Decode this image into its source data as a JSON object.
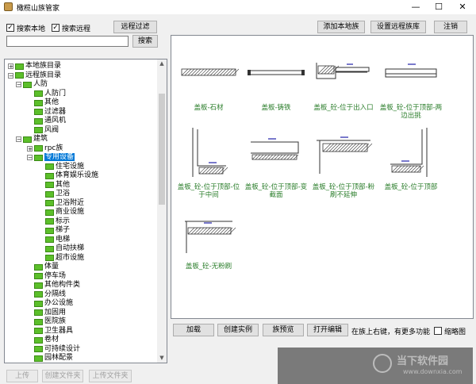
{
  "window": {
    "title": "橄榄山族管家",
    "minimize": "—",
    "maximize": "☐",
    "close": "✕"
  },
  "search": {
    "local_label": "搜索本地",
    "remote_label": "搜索远程",
    "local_checked": true,
    "remote_checked": true,
    "remote_filter_btn": "远程过滤",
    "query_value": "",
    "search_btn": "搜索"
  },
  "topbar": {
    "add_local": "添加本地族",
    "set_remote": "设置远程族库",
    "logout": "注销"
  },
  "tree": [
    {
      "label": "本地族目录",
      "level": 0,
      "expander": "+"
    },
    {
      "label": "远程族目录",
      "level": 0,
      "expander": "−"
    },
    {
      "label": "人防",
      "level": 1,
      "expander": "−"
    },
    {
      "label": "人防门",
      "level": 2,
      "expander": ""
    },
    {
      "label": "其他",
      "level": 2,
      "expander": ""
    },
    {
      "label": "过滤器",
      "level": 2,
      "expander": ""
    },
    {
      "label": "通风机",
      "level": 2,
      "expander": ""
    },
    {
      "label": "风阀",
      "level": 2,
      "expander": ""
    },
    {
      "label": "建筑",
      "level": 1,
      "expander": "−"
    },
    {
      "label": "rpc族",
      "level": 2,
      "expander": "+"
    },
    {
      "label": "专用设备",
      "level": 2,
      "expander": "−",
      "selected": true
    },
    {
      "label": "住宅设施",
      "level": 3,
      "expander": ""
    },
    {
      "label": "体育娱乐设施",
      "level": 3,
      "expander": ""
    },
    {
      "label": "其他",
      "level": 3,
      "expander": ""
    },
    {
      "label": "卫浴",
      "level": 3,
      "expander": ""
    },
    {
      "label": "卫浴附近",
      "level": 3,
      "expander": ""
    },
    {
      "label": "商业设施",
      "level": 3,
      "expander": ""
    },
    {
      "label": "标示",
      "level": 3,
      "expander": ""
    },
    {
      "label": "梯子",
      "level": 3,
      "expander": ""
    },
    {
      "label": "电梯",
      "level": 3,
      "expander": ""
    },
    {
      "label": "自动扶梯",
      "level": 3,
      "expander": ""
    },
    {
      "label": "超市设施",
      "level": 3,
      "expander": ""
    },
    {
      "label": "体量",
      "level": 2,
      "expander": ""
    },
    {
      "label": "停车场",
      "level": 2,
      "expander": ""
    },
    {
      "label": "其他构件类",
      "level": 2,
      "expander": ""
    },
    {
      "label": "分隔线",
      "level": 2,
      "expander": ""
    },
    {
      "label": "办公设施",
      "level": 2,
      "expander": ""
    },
    {
      "label": "加固用",
      "level": 2,
      "expander": ""
    },
    {
      "label": "医院族",
      "level": 2,
      "expander": ""
    },
    {
      "label": "卫生器具",
      "level": 2,
      "expander": ""
    },
    {
      "label": "卷材",
      "level": 2,
      "expander": ""
    },
    {
      "label": "可持续设计",
      "level": 2,
      "expander": ""
    },
    {
      "label": "园林配景",
      "level": 2,
      "expander": ""
    }
  ],
  "tree_buttons": {
    "up": "上传",
    "mkdir": "创建文件夹",
    "upload_file": "上传文件夹"
  },
  "items": [
    {
      "caption": "盖板-石材",
      "icon": "stone-slab-icon"
    },
    {
      "caption": "盖板-铸铁",
      "icon": "cast-iron-slab-icon"
    },
    {
      "caption": "盖板_砼-位于出入口",
      "icon": "concrete-slab-entrance-icon"
    },
    {
      "caption": "盖板_砼-位于顶部-两边出挑",
      "icon": "concrete-slab-top-overhang-icon"
    },
    {
      "caption": "盖板_砼-位于顶部-位于中间",
      "icon": "concrete-slab-top-middle-icon"
    },
    {
      "caption": "盖板_砼-位于顶部-变截面",
      "icon": "concrete-slab-top-variable-icon"
    },
    {
      "caption": "盖板_砼-位于顶部-粉刷不延伸",
      "icon": "concrete-slab-top-plaster-icon"
    },
    {
      "caption": "盖板_砼-位于顶部",
      "icon": "concrete-slab-top-icon"
    },
    {
      "caption": "盖板_砼-无粉刷",
      "icon": "concrete-slab-no-plaster-icon"
    }
  ],
  "actions": {
    "load": "加载",
    "create": "创建实例",
    "preview": "族预览",
    "open_edit": "打开编辑",
    "hint": "在族上右键，有更多功能",
    "thumbnail_label": "缩略图",
    "thumbnail_checked": false
  },
  "watermark": {
    "brand": "当下软件园",
    "url": "www.downxia.com"
  }
}
